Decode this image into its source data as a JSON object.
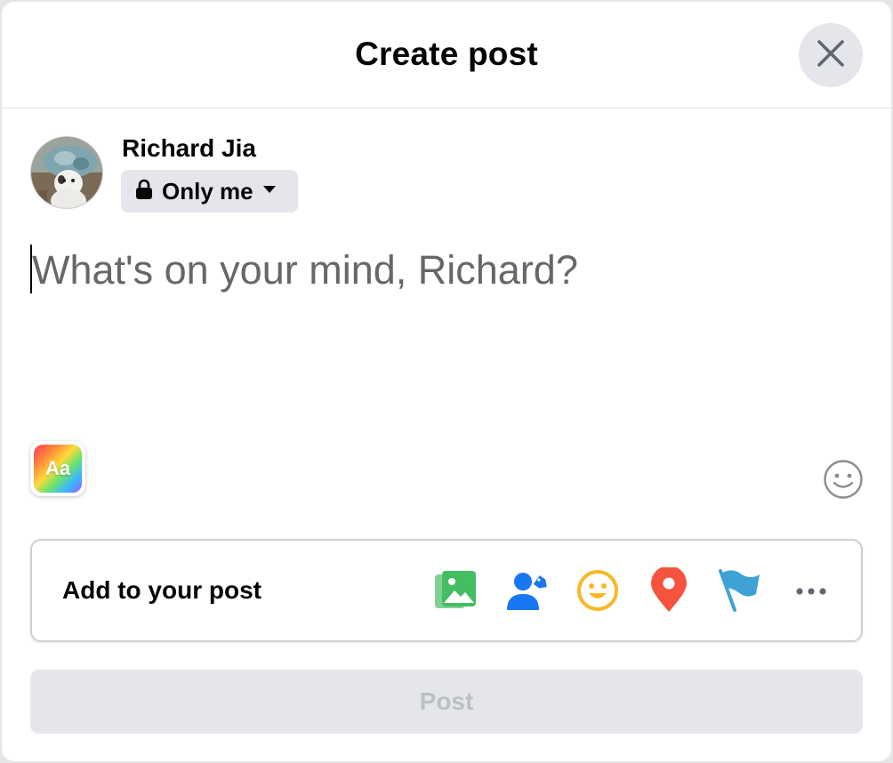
{
  "dialog": {
    "title": "Create post"
  },
  "user": {
    "name": "Richard Jia"
  },
  "privacy": {
    "label": "Only me",
    "icon": "lock-icon"
  },
  "composer": {
    "placeholder": "What's on your mind, Richard?"
  },
  "background_picker": {
    "label": "Aa"
  },
  "add_to_post": {
    "label": "Add to your post",
    "actions": [
      {
        "name": "photo-video-icon",
        "color": "#45bd62"
      },
      {
        "name": "tag-people-icon",
        "color": "#1877f2"
      },
      {
        "name": "feeling-activity-icon",
        "color": "#f7b928"
      },
      {
        "name": "check-in-icon",
        "color": "#f5533d"
      },
      {
        "name": "life-event-icon",
        "color": "#3ea2d6"
      },
      {
        "name": "more-icon",
        "color": "#606770"
      }
    ]
  },
  "post_button": {
    "label": "Post",
    "enabled": false
  },
  "colors": {
    "surface": "#ffffff",
    "button_bg": "#e4e6eb",
    "placeholder": "#65676b",
    "disabled_text": "#bcc0c4"
  }
}
